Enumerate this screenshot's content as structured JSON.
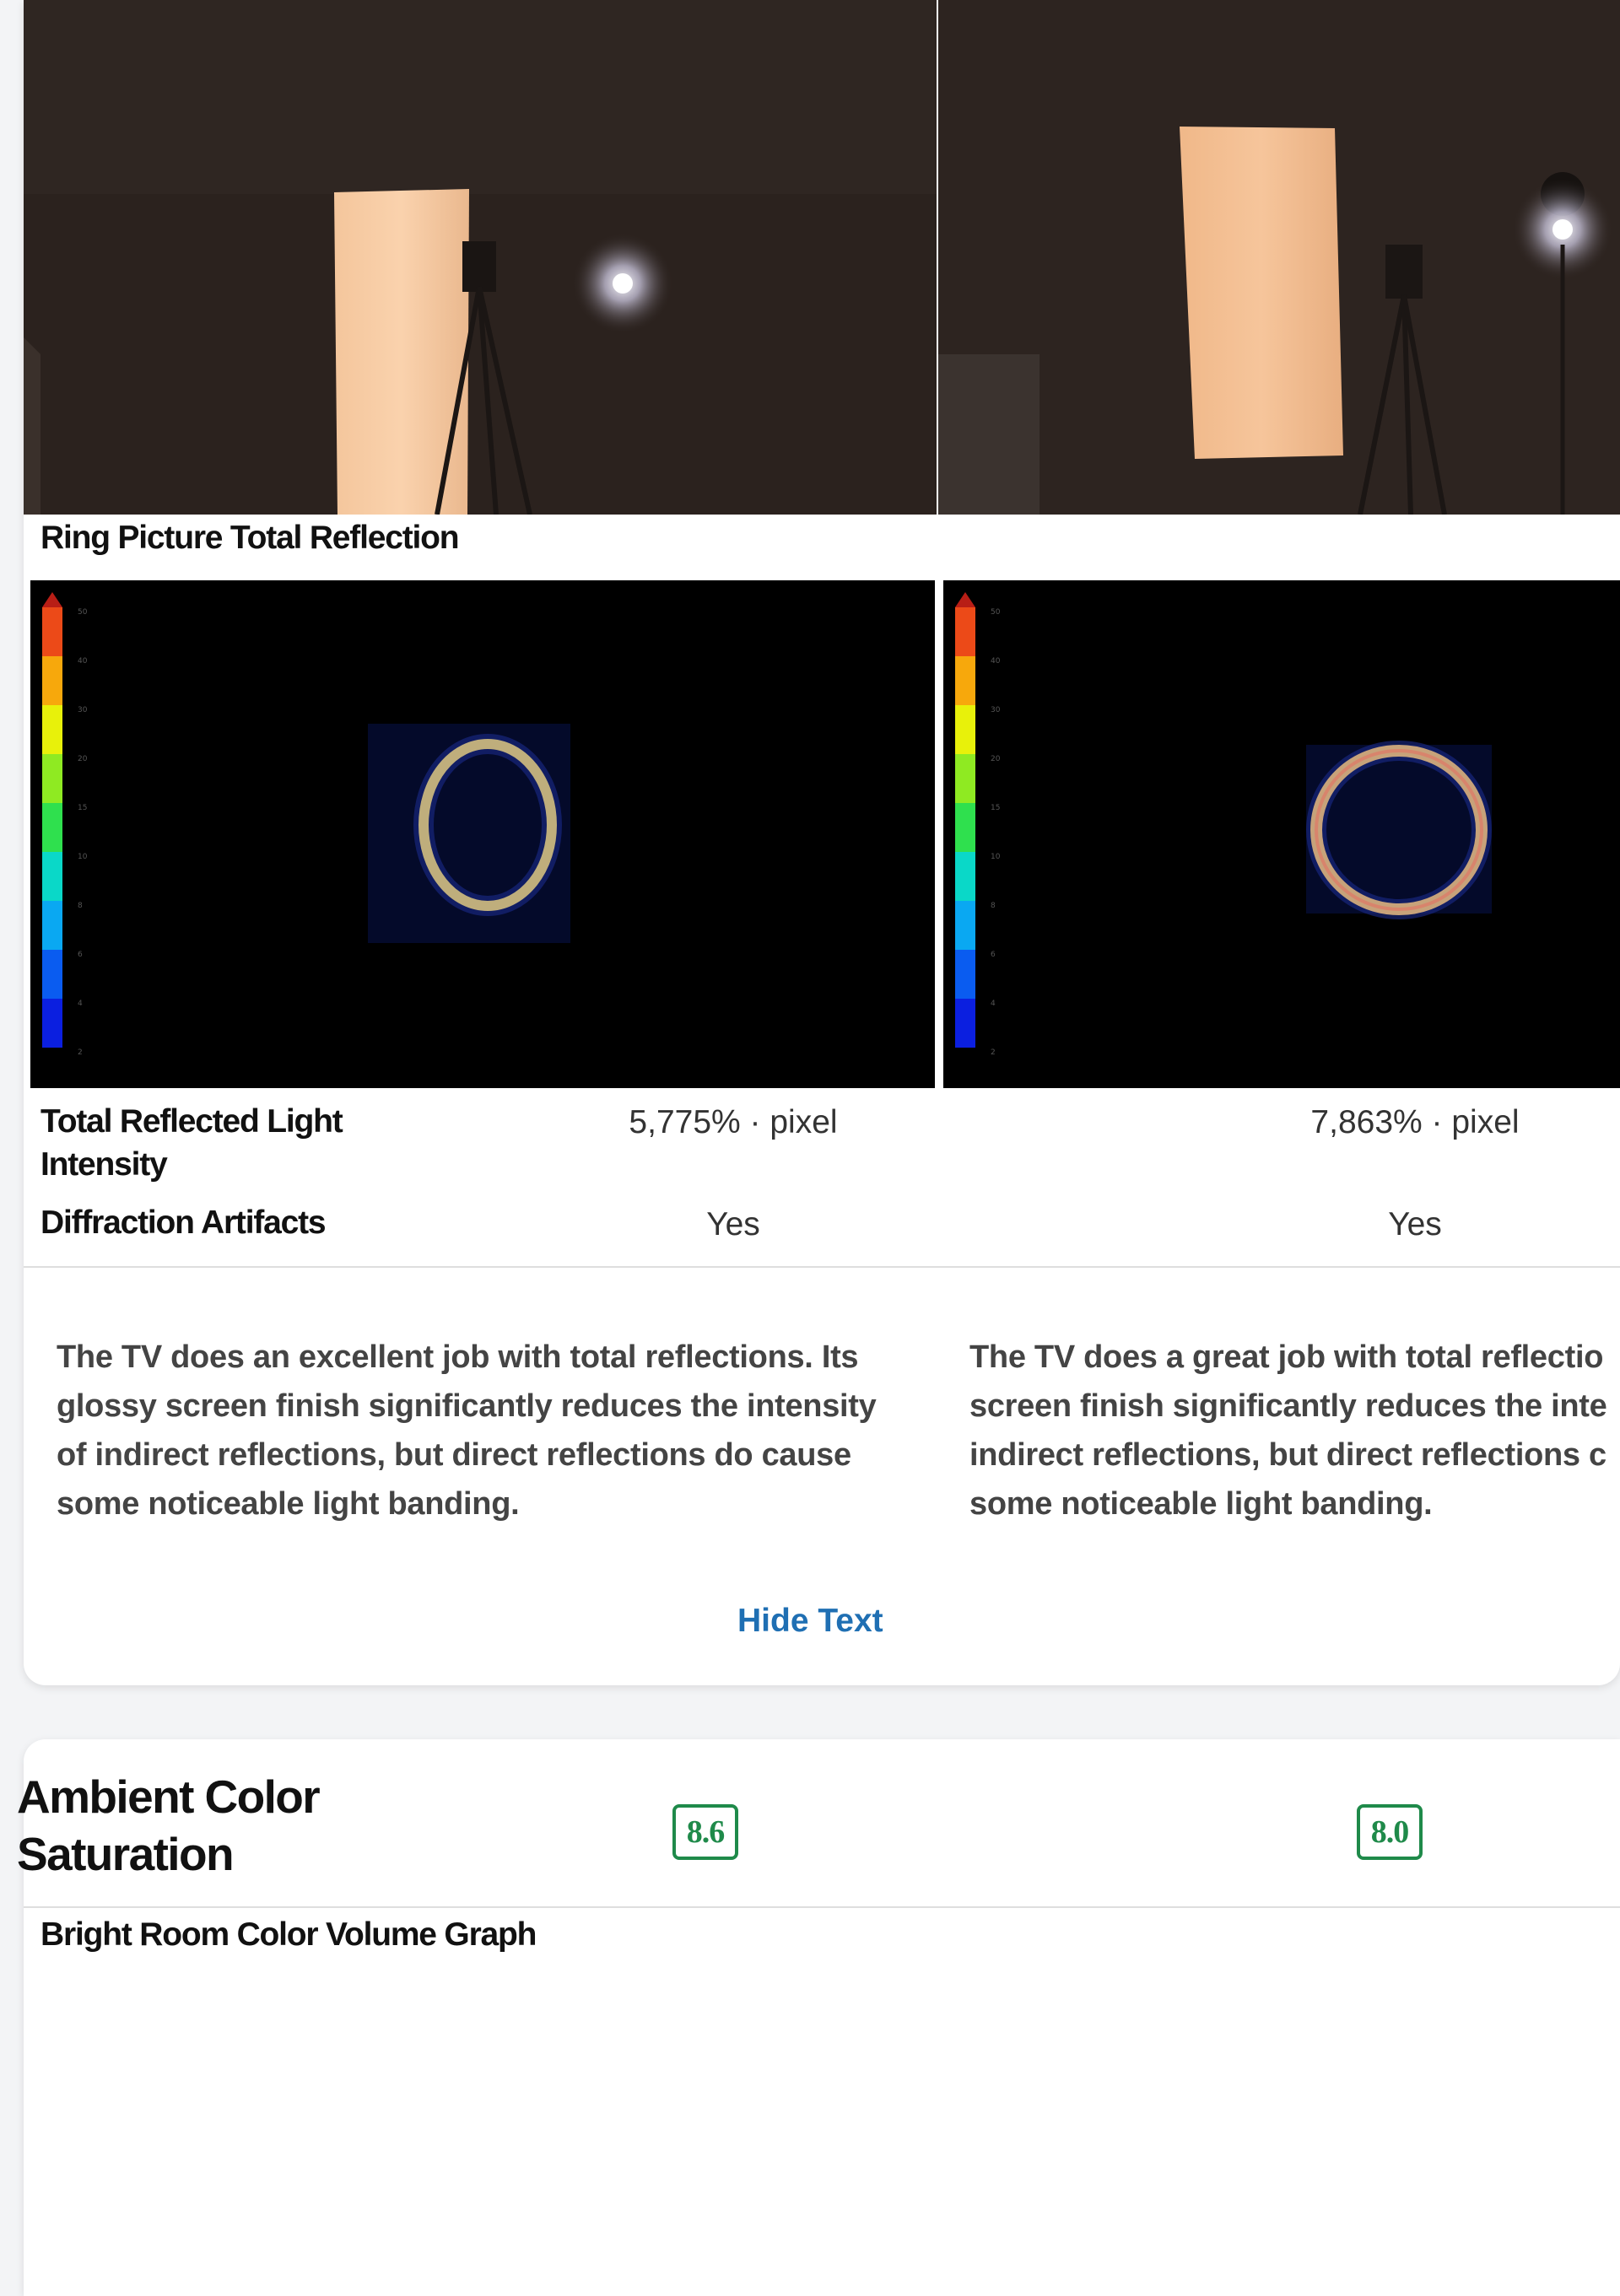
{
  "reflections": {
    "ring_picture_label": "Ring Picture Total Reflection",
    "rows": [
      {
        "label": "Total Reflected Light Intensity",
        "left": "5,775% · pixel",
        "right": "7,863% · pixel"
      },
      {
        "label": "Diffraction Artifacts",
        "left": "Yes",
        "right": "Yes"
      }
    ],
    "scale_ticks": [
      "50",
      "40",
      "30",
      "20",
      "15",
      "10",
      "8",
      "6",
      "4",
      "2"
    ],
    "descriptions": {
      "left": [
        "The TV does an excellent job with total reflections. Its",
        "glossy screen finish significantly reduces the intensity",
        "of indirect reflections, but direct reflections do cause",
        "some noticeable light banding."
      ],
      "right": [
        "The TV does a great job with total reflectio",
        "screen finish significantly reduces the inte",
        "indirect reflections, but direct reflections c",
        "some noticeable light banding."
      ]
    },
    "hide_text_label": "Hide Text"
  },
  "ambient": {
    "title_lines": [
      "Ambient Color",
      "Saturation"
    ],
    "score_left": "8.6",
    "score_right": "8.0",
    "graph_label": "Bright Room Color Volume Graph"
  },
  "colors": {
    "score_green": "#1f8a4a",
    "link_blue": "#1f6fb3"
  }
}
